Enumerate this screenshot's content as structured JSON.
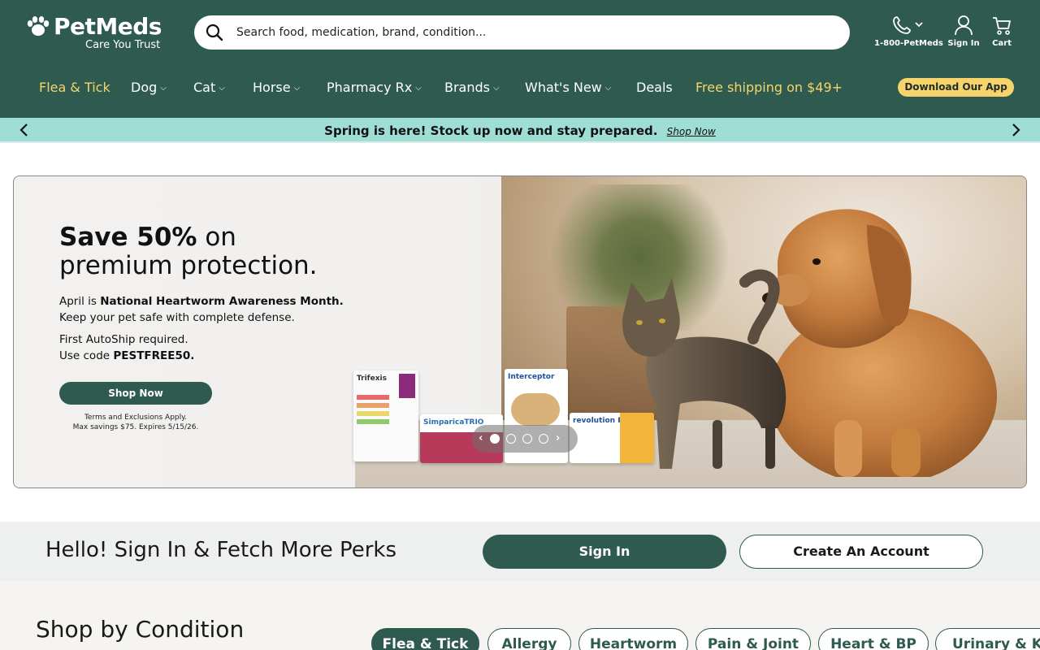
{
  "brand": {
    "name": "PetMeds",
    "tagline": "Care You Trust"
  },
  "search": {
    "placeholder": "Search food, medication, brand, condition..."
  },
  "utility": {
    "phone_label": "1-800-PetMeds",
    "signin_label": "Sign In",
    "cart_label": "Cart"
  },
  "nav": {
    "items": [
      {
        "label": "Flea & Tick",
        "dropdown": false,
        "highlight": true
      },
      {
        "label": "Dog",
        "dropdown": true
      },
      {
        "label": "Cat",
        "dropdown": true
      },
      {
        "label": "Horse",
        "dropdown": true
      },
      {
        "label": "Pharmacy Rx",
        "dropdown": true
      },
      {
        "label": "Brands",
        "dropdown": true
      },
      {
        "label": "What's New",
        "dropdown": true
      },
      {
        "label": "Deals",
        "dropdown": false
      },
      {
        "label": "Free shipping on $49+",
        "dropdown": false,
        "highlight": true
      }
    ],
    "app_button": "Download Our App"
  },
  "promo": {
    "text": "Spring is here! Stock up now and stay prepared.",
    "link": "Shop Now"
  },
  "hero": {
    "headline_bold": "Save 50%",
    "headline_rest": " on",
    "headline_line2": "premium protection.",
    "line1_pre": "April is ",
    "line1_bold": "National Heartworm Awareness Month.",
    "line2": "Keep your pet safe with complete defense.",
    "line3": "First AutoShip required.",
    "line4_pre": "Use code ",
    "line4_bold": "PESTFREE50.",
    "cta": "Shop Now",
    "terms1": "Terms and Exclusions Apply.",
    "terms2": "Max savings $75. Expires 5/15/26.",
    "products": [
      "Trifexis",
      "SimparicaTRIO",
      "Interceptor",
      "revolution PLUS"
    ],
    "carousel_total": 4,
    "carousel_active": 1
  },
  "signin_strip": {
    "title": "Hello! Sign In & Fetch More Perks",
    "signin_button": "Sign In",
    "create_button": "Create An Account"
  },
  "condition": {
    "title": "Shop by Condition",
    "chips": [
      "Flea & Tick",
      "Allergy",
      "Heartworm",
      "Pain & Joint",
      "Heart & BP",
      "Urinary & Kidney"
    ],
    "active": "Flea & Tick"
  },
  "colors": {
    "primary": "#2e5a50",
    "accent_yellow": "#f6d46b",
    "promo_bg": "#9fded5"
  }
}
